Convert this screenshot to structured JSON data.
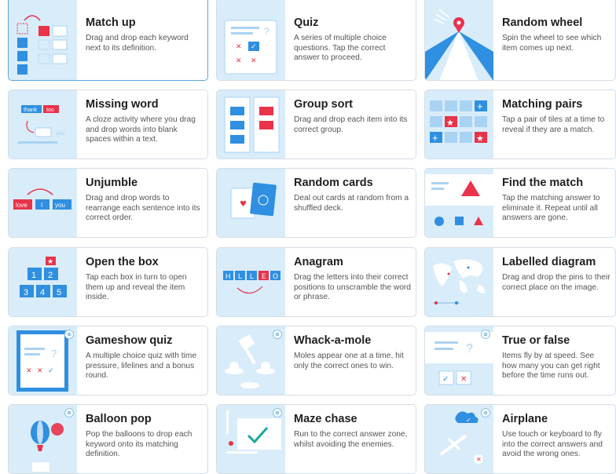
{
  "templates": [
    {
      "title": "Match up",
      "desc": "Drag and drop each keyword next to its definition.",
      "icon": "match-up-icon"
    },
    {
      "title": "Quiz",
      "desc": "A series of multiple choice questions. Tap the correct answer to proceed.",
      "icon": "quiz-icon"
    },
    {
      "title": "Random wheel",
      "desc": "Spin the wheel to see which item comes up next.",
      "icon": "random-wheel-icon"
    },
    {
      "title": "Missing word",
      "desc": "A cloze activity where you drag and drop words into blank spaces within a text.",
      "icon": "missing-word-icon",
      "thumb_words": [
        "thank",
        "too",
        "you"
      ]
    },
    {
      "title": "Group sort",
      "desc": "Drag and drop each item into its correct group.",
      "icon": "group-sort-icon"
    },
    {
      "title": "Matching pairs",
      "desc": "Tap a pair of tiles at a time to reveal if they are a match.",
      "icon": "matching-pairs-icon"
    },
    {
      "title": "Unjumble",
      "desc": "Drag and drop words to rearrange each sentence into its correct order.",
      "icon": "unjumble-icon",
      "thumb_words": [
        "love",
        "I",
        "you"
      ]
    },
    {
      "title": "Random cards",
      "desc": "Deal out cards at random from a shuffled deck.",
      "icon": "random-cards-icon"
    },
    {
      "title": "Find the match",
      "desc": "Tap the matching answer to eliminate it. Repeat until all answers are gone.",
      "icon": "find-the-match-icon"
    },
    {
      "title": "Open the box",
      "desc": "Tap each box in turn to open them up and reveal the item inside.",
      "icon": "open-the-box-icon",
      "thumb_numbers": [
        "1",
        "2",
        "3",
        "4",
        "5"
      ]
    },
    {
      "title": "Anagram",
      "desc": "Drag the letters into their correct positions to unscramble the word or phrase.",
      "icon": "anagram-icon",
      "thumb_letters": [
        "H",
        "L",
        "L",
        "E",
        "O"
      ]
    },
    {
      "title": "Labelled diagram",
      "desc": "Drag and drop the pins to their correct place on the image.",
      "icon": "labelled-diagram-icon"
    },
    {
      "title": "Gameshow quiz",
      "desc": "A multiple choice quiz with time pressure, lifelines and a bonus round.",
      "icon": "gameshow-quiz-icon",
      "badge": true
    },
    {
      "title": "Whack-a-mole",
      "desc": "Moles appear one at a time, hit only the correct ones to win.",
      "icon": "whack-a-mole-icon",
      "badge": true
    },
    {
      "title": "True or false",
      "desc": "Items fly by at speed. See how many you can get right before the time runs out.",
      "icon": "true-or-false-icon",
      "badge": true
    },
    {
      "title": "Balloon pop",
      "desc": "Pop the balloons to drop each keyword onto its matching definition.",
      "icon": "balloon-pop-icon",
      "badge": true
    },
    {
      "title": "Maze chase",
      "desc": "Run to the correct answer zone, whilst avoiding the enemies.",
      "icon": "maze-chase-icon",
      "badge": true
    },
    {
      "title": "Airplane",
      "desc": "Use touch or keyboard to fly into the correct answers and avoid the wrong ones.",
      "icon": "airplane-icon",
      "badge": true
    }
  ],
  "colors": {
    "accent": "#2f8fe0",
    "red": "#e8334a",
    "thumb_bg": "#d8ecfa",
    "border": "#d5dde6"
  }
}
